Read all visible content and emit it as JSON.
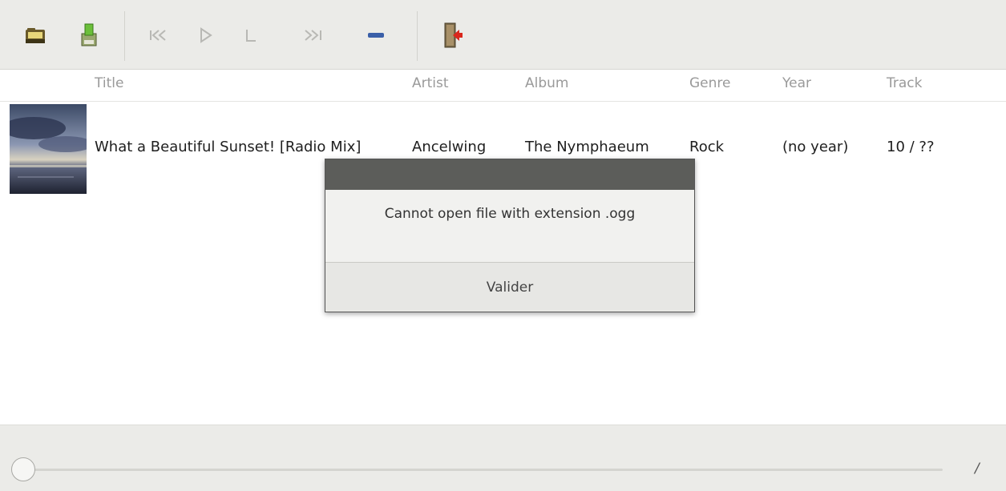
{
  "toolbar": {
    "buttons": [
      {
        "icon": "folder-icon",
        "label": ""
      },
      {
        "icon": "save-icon",
        "label": ""
      },
      {
        "icon": "previous-icon",
        "label": ""
      },
      {
        "icon": "play-icon",
        "label": ""
      },
      {
        "icon": "stop-icon",
        "label": ""
      },
      {
        "icon": "next-icon",
        "label": ""
      },
      {
        "icon": "remove-icon",
        "label": ""
      },
      {
        "icon": "quit-icon",
        "label": ""
      }
    ]
  },
  "columns": {
    "title": "Title",
    "artist": "Artist",
    "album": "Album",
    "genre": "Genre",
    "year": "Year",
    "track": "Track"
  },
  "rows": [
    {
      "title": "What a Beautiful Sunset! [Radio Mix]",
      "artist": "Ancelwing",
      "album": "The Nymphaeum",
      "genre": "Rock",
      "year": "(no year)",
      "track": "10 / ??"
    }
  ],
  "dialog": {
    "message": "Cannot open file with extension .ogg",
    "button_label": "Valider"
  },
  "player": {
    "progress": 0,
    "time_text": "/"
  },
  "colors": {
    "toolbar_bg": "#ebebe8",
    "dialog_title_bg": "#5c5d5a",
    "remove_blue": "#3a5fa8",
    "quit_red": "#d9261c"
  }
}
